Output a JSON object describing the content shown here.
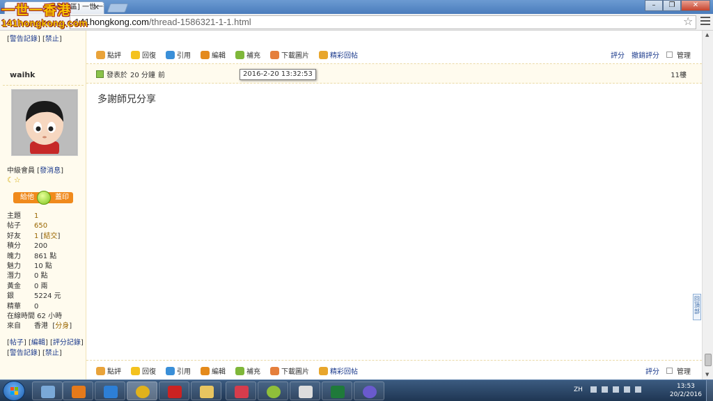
{
  "browser": {
    "tab_title": "[新聞區] 一世一香港 Pa",
    "url_host": "141hongkong.com",
    "url_path": "/thread-1586321-1-1.html"
  },
  "logo": {
    "line1": "一世一香港",
    "line2": "141hongkong.com"
  },
  "sidebar_top": {
    "warn": "警告記錄",
    "ban": "禁止"
  },
  "actions": [
    {
      "label": "點評",
      "icon": "rate-icon",
      "color": "#e9a33a"
    },
    {
      "label": "回復",
      "icon": "reply-icon",
      "color": "#f4c21f"
    },
    {
      "label": "引用",
      "icon": "quote-icon",
      "color": "#3a8fd8"
    },
    {
      "label": "編輯",
      "icon": "edit-icon",
      "color": "#e48a1c"
    },
    {
      "label": "補充",
      "icon": "supplement-icon",
      "color": "#7fb73a"
    },
    {
      "label": "下載圖片",
      "icon": "download-image-icon",
      "color": "#e57f3c"
    },
    {
      "label": "精彩回帖",
      "icon": "highlight-reply-icon",
      "color": "#e8a62c"
    }
  ],
  "right_actions": {
    "rate": "評分",
    "cancel_rate": "撤銷評分",
    "manage": "管理"
  },
  "post": {
    "author": "waihk",
    "posted_prefix": "發表於",
    "posted_time": "20 分鐘",
    "posted_suffix": "前",
    "tooltip": "2016-2-20 13:32:53",
    "floor": "11樓",
    "content": "多謝師兄分享"
  },
  "user": {
    "rank": "中級會員",
    "message": "發消息",
    "give": "給他",
    "stamp": "蓋印",
    "stats": [
      {
        "k": "主題",
        "v": "1",
        "link": true
      },
      {
        "k": "帖子",
        "v": "650",
        "link": true
      },
      {
        "k": "好友",
        "v": "1",
        "link": true,
        "extra": "結交"
      },
      {
        "k": "積分",
        "v": "200"
      },
      {
        "k": "魄力",
        "v": "861 點"
      },
      {
        "k": "魅力",
        "v": "10 點"
      },
      {
        "k": "潛力",
        "v": "0 點"
      },
      {
        "k": "黃金",
        "v": "0 兩"
      },
      {
        "k": "銀",
        "v": "5224 元"
      },
      {
        "k": "精華",
        "v": "0"
      }
    ],
    "online": "在線時間 62 小時",
    "from_label": "來自",
    "from_value": "香港",
    "alias": "分身",
    "links": {
      "posts": "帖子",
      "edit": "編輯",
      "rate_log": "評分記錄",
      "warn": "警告記錄",
      "ban": "禁止"
    }
  },
  "bottom_bar": {
    "rate": "評分",
    "manage": "管理"
  },
  "backtop": "回頂部",
  "taskbar": {
    "lang": "ZH",
    "time": "13:53",
    "date": "20/2/2016",
    "apps": [
      {
        "name": "notes",
        "color": "#7aa9d8"
      },
      {
        "name": "media-player",
        "color": "#e57a1b"
      },
      {
        "name": "internet-explorer",
        "color": "#2d7fd6"
      },
      {
        "name": "chrome",
        "color": "#e0b21c"
      },
      {
        "name": "pulse-monitor",
        "color": "#cc2222"
      },
      {
        "name": "file-explorer",
        "color": "#e9c560"
      },
      {
        "name": "slideshow",
        "color": "#d63c4c"
      },
      {
        "name": "color-wheel",
        "color": "#8fbf3a"
      },
      {
        "name": "calculator",
        "color": "#dddddd"
      },
      {
        "name": "excel",
        "color": "#1f7a3a"
      },
      {
        "name": "disc-player",
        "color": "#6a5acd"
      }
    ]
  }
}
